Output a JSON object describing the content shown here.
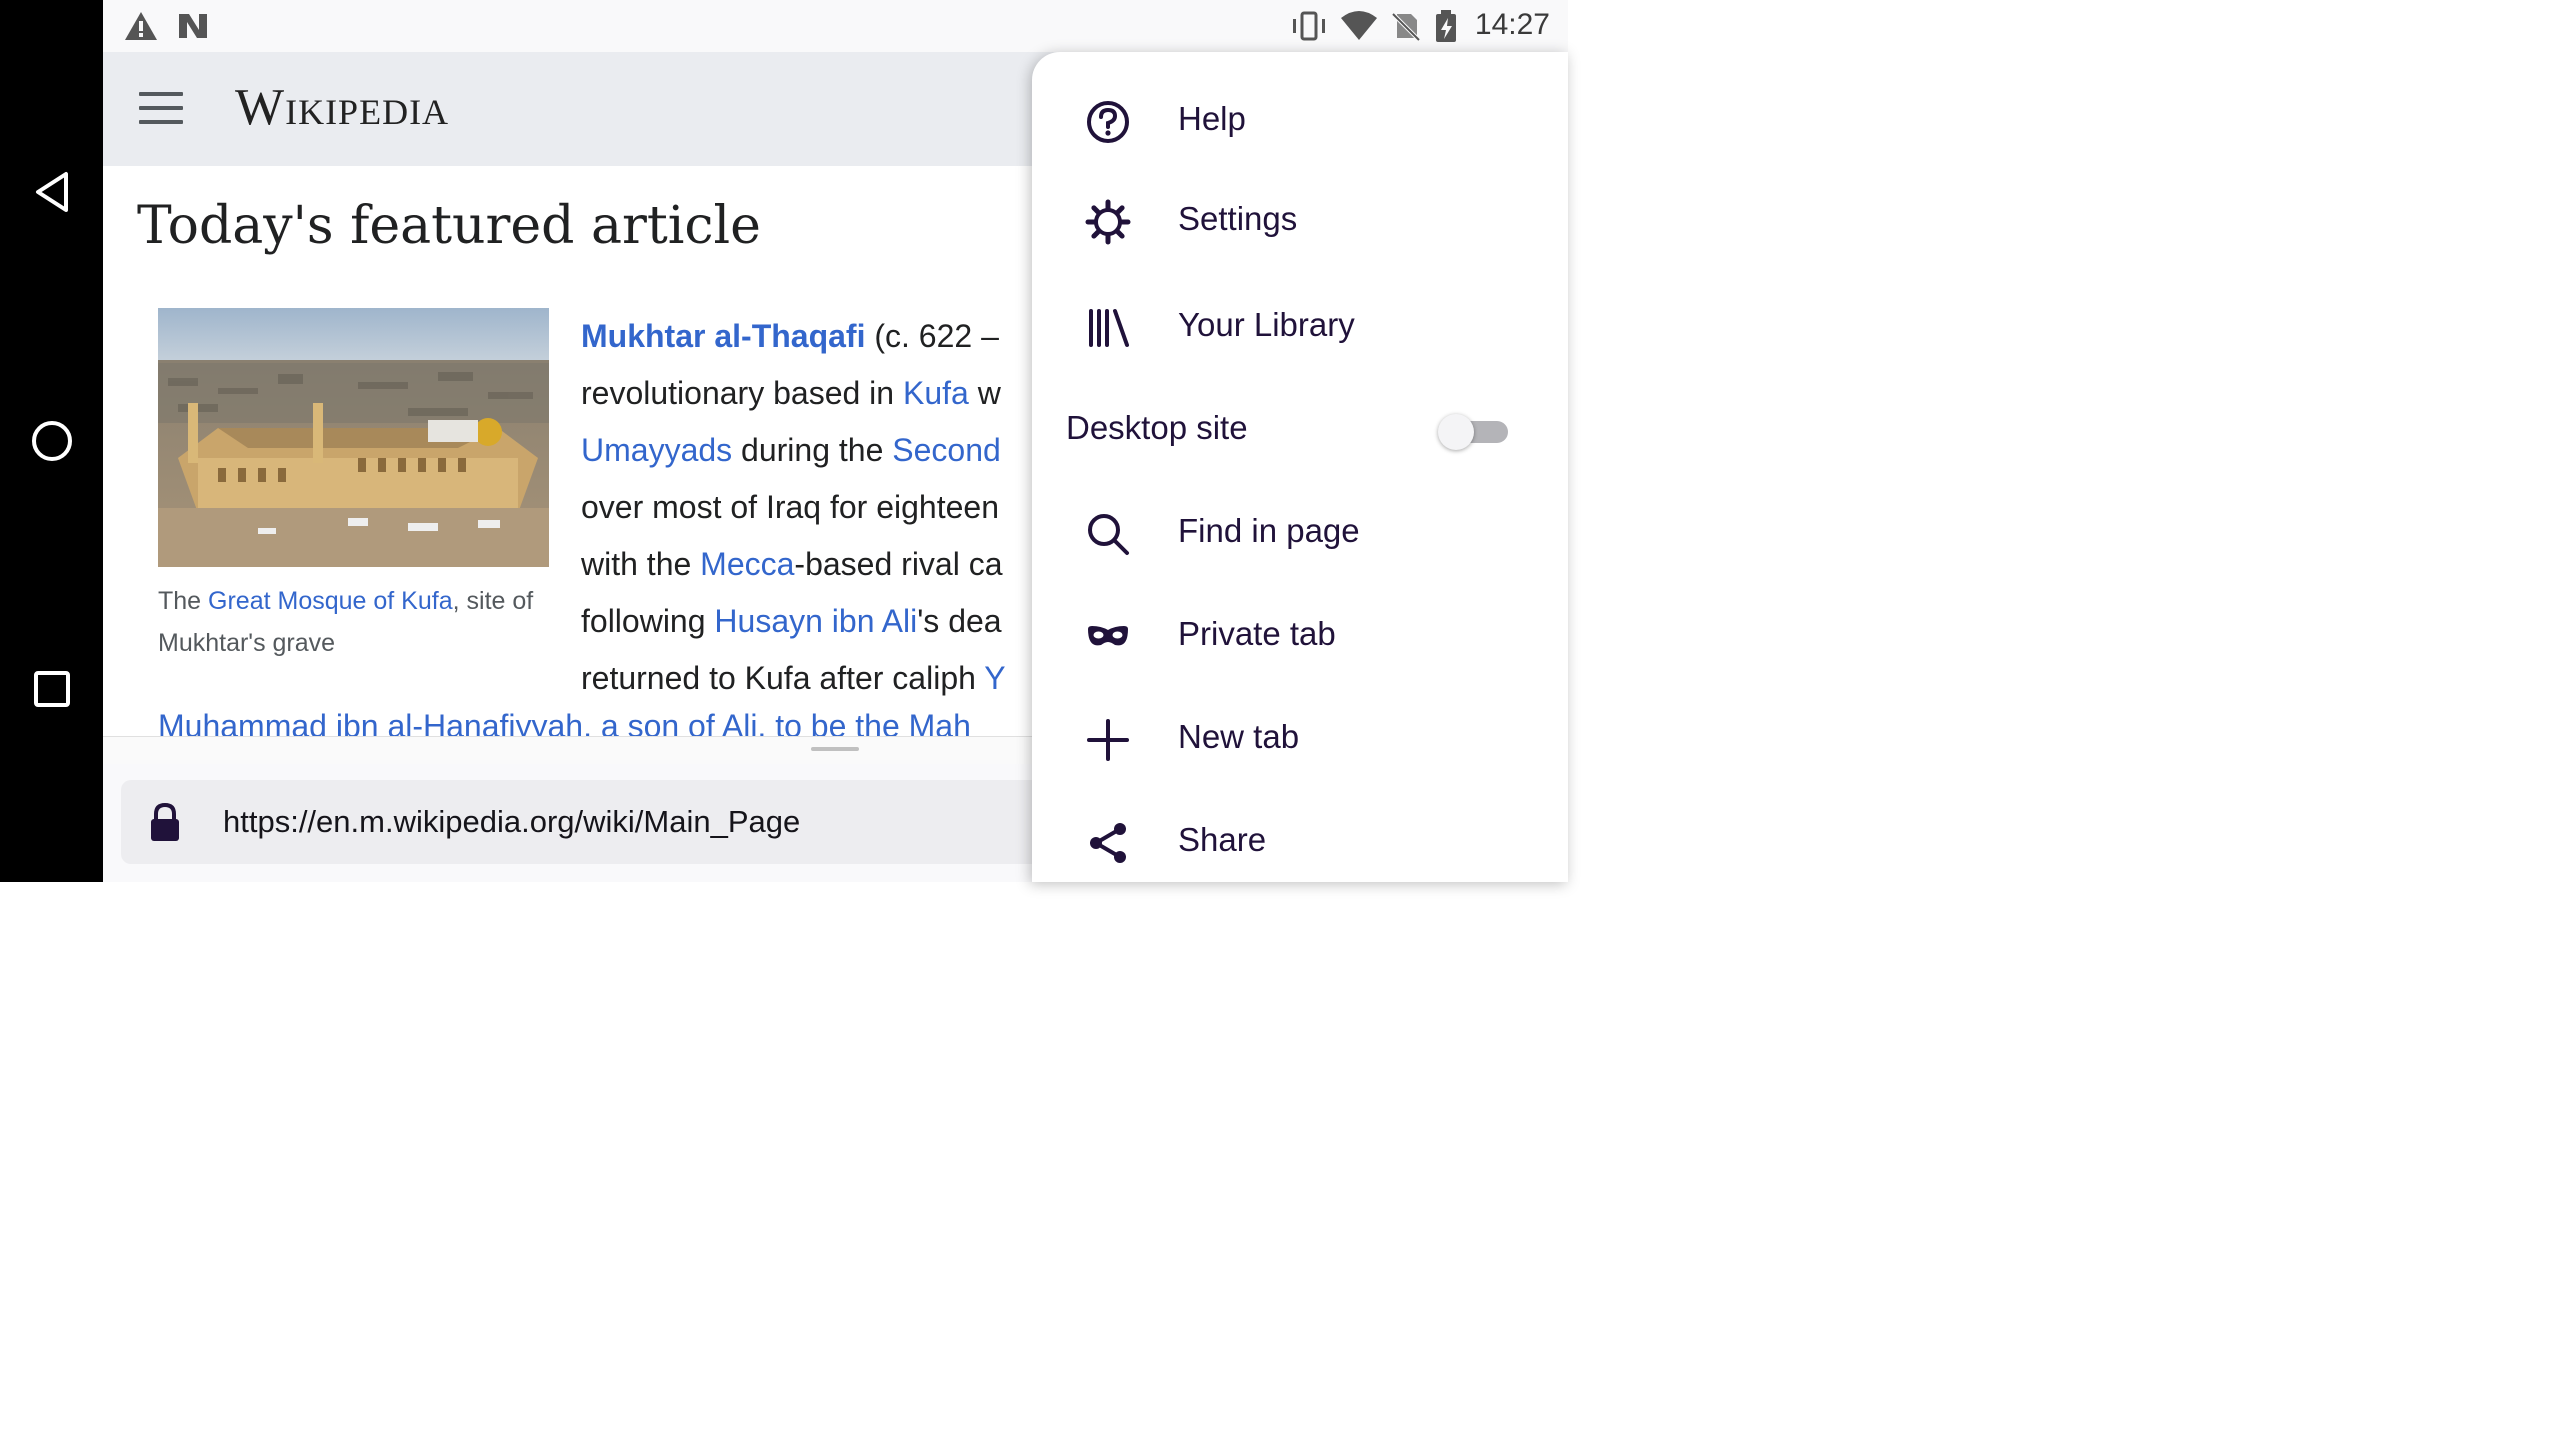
{
  "status_bar": {
    "time": "14:27"
  },
  "header": {
    "logo_text": "Wikipedia"
  },
  "article": {
    "heading": "Today's featured article",
    "caption_pre": "The ",
    "caption_link": "Great Mosque of Kufa",
    "caption_post": ", site of Mukhtar's grave",
    "lines": [
      [
        {
          "t": "Mukhtar al-Thaqafi",
          "k": "boldlink"
        },
        {
          "t": " (c. 622 –",
          "k": "text"
        }
      ],
      [
        {
          "t": "revolutionary based in ",
          "k": "text"
        },
        {
          "t": "Kufa",
          "k": "link"
        },
        {
          "t": " w",
          "k": "text"
        }
      ],
      [
        {
          "t": "Umayyads",
          "k": "link"
        },
        {
          "t": " during the ",
          "k": "text"
        },
        {
          "t": "Second",
          "k": "link"
        }
      ],
      [
        {
          "t": "over most of Iraq for eighteen",
          "k": "text"
        }
      ],
      [
        {
          "t": "with the ",
          "k": "text"
        },
        {
          "t": "Mecca",
          "k": "link"
        },
        {
          "t": "-based rival ca",
          "k": "text"
        }
      ],
      [
        {
          "t": "following ",
          "k": "text"
        },
        {
          "t": "Husayn ibn Ali",
          "k": "link"
        },
        {
          "t": "'s dea",
          "k": "text"
        }
      ],
      [
        {
          "t": "returned to Kufa after caliph ",
          "k": "text"
        },
        {
          "t": "Y",
          "k": "link"
        }
      ]
    ],
    "cut_line": "Muhammad ibn al-Hanafiyyah, a son of Ali, to be the Mah"
  },
  "toolbar": {
    "url": "https://en.m.wikipedia.org/wiki/Main_Page"
  },
  "menu": {
    "help": "Help",
    "settings": "Settings",
    "library": "Your Library",
    "desktop_site": "Desktop site",
    "desktop_site_enabled": false,
    "find": "Find in page",
    "private": "Private tab",
    "new_tab": "New tab",
    "share": "Share"
  }
}
